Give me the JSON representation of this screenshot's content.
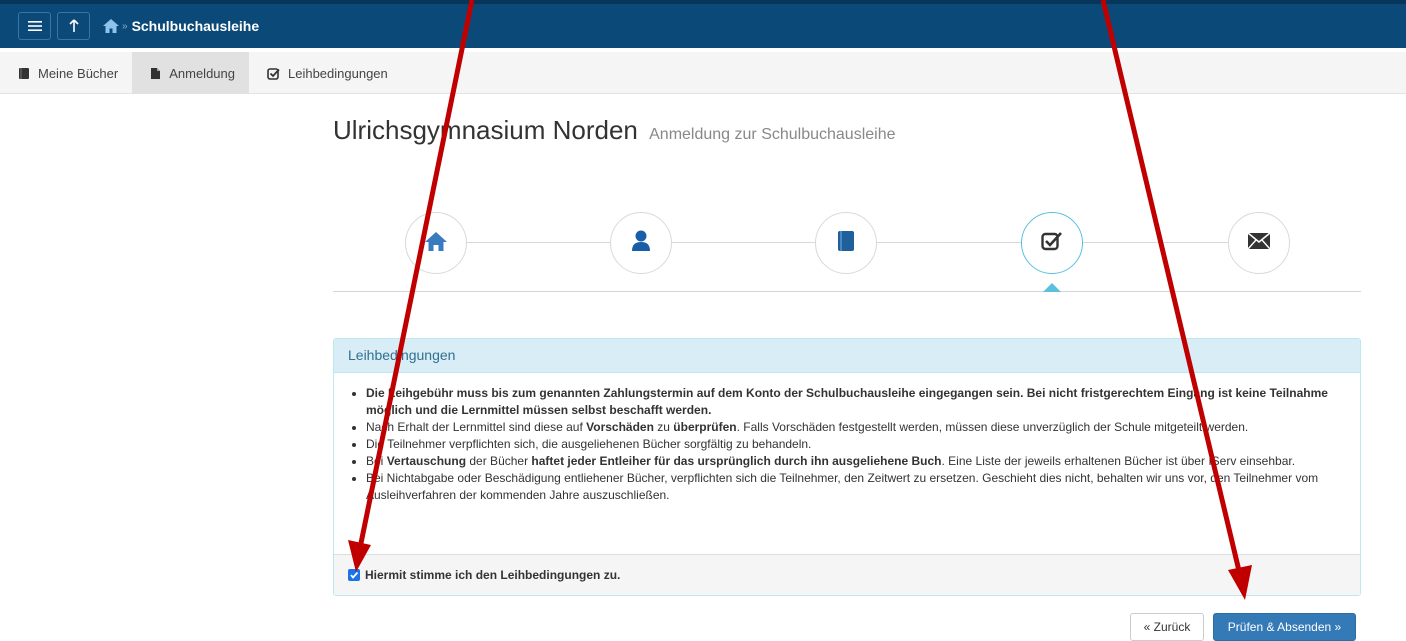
{
  "topbar": {
    "menu_icon": "menu-icon",
    "up_icon": "arrow-up-icon",
    "home_icon": "home-icon",
    "separator": "»",
    "title": "Schulbuchausleihe"
  },
  "subnav": {
    "items": [
      {
        "label": "Meine Bücher",
        "icon": "book-icon"
      },
      {
        "label": "Anmeldung",
        "icon": "file-icon",
        "active": true
      },
      {
        "label": "Leihbedingungen",
        "icon": "check-square-icon"
      }
    ]
  },
  "page": {
    "title": "Ulrichsgymnasium Norden",
    "subtitle": "Anmeldung zur Schulbuchausleihe"
  },
  "stepper": {
    "steps": [
      {
        "icon": "home-icon"
      },
      {
        "icon": "user-icon"
      },
      {
        "icon": "book-icon"
      },
      {
        "icon": "check-square-icon",
        "active": true
      },
      {
        "icon": "envelope-icon"
      }
    ],
    "accent": "#5bc0de"
  },
  "panel": {
    "title": "Leihbedingungen",
    "items": {
      "i1_bold": "Die Leihgebühr muss bis zum genannten Zahlungstermin auf dem Konto der Schulbuchausleihe eingegangen sein. Bei nicht fristgerechtem Eingang ist keine Teilnahme möglich und die Lernmittel müssen selbst beschafft werden.",
      "i2_a": "Nach Erhalt der Lernmittel sind diese auf ",
      "i2_b": "Vorschäden",
      "i2_c": " zu ",
      "i2_d": "überprüfen",
      "i2_e": ". Falls Vorschäden festgestellt werden, müssen diese unverzüglich der Schule mitgeteilt werden.",
      "i3": "Die Teilnehmer verpflichten sich, die ausgeliehenen Bücher sorgfältig zu behandeln.",
      "i4_a": "Bei ",
      "i4_b": "Vertauschung",
      "i4_c": " der Bücher ",
      "i4_d": "haftet jeder Entleiher für das ursprünglich durch ihn ausgeliehene Buch",
      "i4_e": ". Eine Liste der jeweils erhaltenen Bücher ist über IServ einsehbar.",
      "i5": "Bei Nichtabgabe oder Beschädigung entliehener Bücher, verpflichten sich die Teilnehmer, den Zeitwert zu ersetzen. Geschieht dies nicht, behalten wir uns vor, den Teilnehmer vom Ausleihverfahren der kommenden Jahre auszuschließen."
    },
    "checkbox_label": "Hiermit stimme ich den Leihbedingungen zu.",
    "checkbox_checked": true,
    "header_bg": "#d9edf7",
    "header_color": "#31708f"
  },
  "buttons": {
    "back": "« Zurück",
    "submit": "Prüfen & Absenden »",
    "submit_color": "#337ab7"
  },
  "annotation_color": "#c00000"
}
